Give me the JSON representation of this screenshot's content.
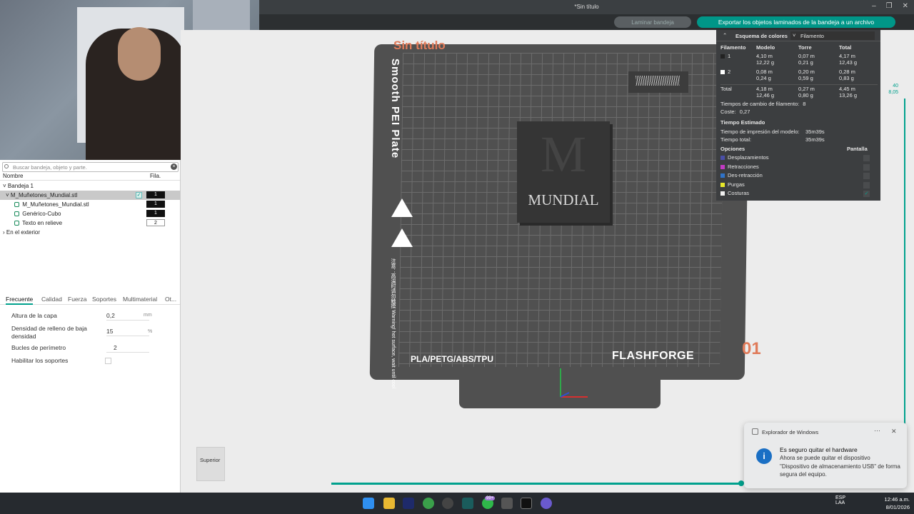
{
  "window": {
    "title": "*Sin título"
  },
  "toolbar": {
    "slice_label": "Laminar bandeja",
    "export_label": "Exportar los objetos laminados de la bandeja a un archivo"
  },
  "left_panel": {
    "search_placeholder": "Buscar bandeja, objeto y parte.",
    "col_name": "Nombre",
    "col_fila": "Fila.",
    "tree": {
      "plate": "Bandeja 1",
      "object": {
        "label": "M_Muñetones_Mundial.stl",
        "fila": "1"
      },
      "parts": [
        {
          "label": "M_Muñetones_Mundial.stl",
          "fila": "1"
        },
        {
          "label": "Genérico-Cubo",
          "fila": "1"
        },
        {
          "label": "Texto en relieve",
          "fila": "2"
        }
      ],
      "outside": "En el exterior"
    },
    "tabs": [
      "Frecuente",
      "Calidad",
      "Fuerza",
      "Soportes",
      "Multimaterial",
      "Ot..."
    ],
    "params": {
      "layer_height": {
        "label": "Altura de la capa",
        "value": "0,2",
        "unit": "mm"
      },
      "infill": {
        "label": "Densidad de relleno de baja densidad",
        "value": "15",
        "unit": "%"
      },
      "walls": {
        "label": "Bucles de perímetro",
        "value": "2"
      },
      "supports": {
        "label": "Habilitar los soportes"
      }
    }
  },
  "plate": {
    "project_title": "Sin título",
    "plate_name": "Smooth PEI Plate",
    "warning_text": "注意：高温时请勿触摸 Warning! hot surface, wait until cool",
    "materials": "PLA/PETG/ABS/TPU",
    "brand": "FLASHFORGE",
    "plate_number": "01",
    "model_letter": "M",
    "model_text": "MUNDIAL"
  },
  "color_scheme": {
    "header": "Esquema de colores",
    "mode": "Filamento",
    "columns": [
      "Filamento",
      "Modelo",
      "Torre",
      "Total"
    ],
    "rows": [
      {
        "id": "1",
        "color": "#222222",
        "model": [
          "4,10 m",
          "12,22 g"
        ],
        "tower": [
          "0,07 m",
          "0,21 g"
        ],
        "total": [
          "4,17 m",
          "12,43 g"
        ]
      },
      {
        "id": "2",
        "color": "#ffffff",
        "model": [
          "0,08 m",
          "0,24 g"
        ],
        "tower": [
          "0,20 m",
          "0,59 g"
        ],
        "total": [
          "0,28 m",
          "0,83 g"
        ]
      }
    ],
    "total_row": {
      "label": "Total",
      "model": [
        "4,18 m",
        "12,46 g"
      ],
      "tower": [
        "0,27 m",
        "0,80 g"
      ],
      "total": [
        "4,45 m",
        "13,26 g"
      ]
    },
    "changes_label": "Tiempos de cambio de filamento:",
    "changes_value": "8",
    "cost_label": "Coste:",
    "cost_value": "0,27",
    "time_header": "Tiempo Estimado",
    "model_time_label": "Tiempo de impresión del modelo:",
    "model_time_value": "35m39s",
    "total_time_label": "Tiempo total:",
    "total_time_value": "35m39s",
    "options_header": "Opciones",
    "screen_header": "Pantalla",
    "options": [
      {
        "label": "Desplazamientos",
        "color": "#4a4fa8"
      },
      {
        "label": "Retracciones",
        "color": "#c23bc2"
      },
      {
        "label": "Des-retracción",
        "color": "#2f73c8"
      },
      {
        "label": "Purgas",
        "color": "#e8e82a"
      },
      {
        "label": "Costuras",
        "color": "#f0f0f0"
      }
    ]
  },
  "slider": {
    "top_layer": "40",
    "top_height": "8,05"
  },
  "view_cube": {
    "label": "Superior"
  },
  "toast": {
    "app": "Explorador de Windows",
    "title": "Es seguro quitar el hardware",
    "message": "Ahora se puede quitar el dispositivo \"Dispositivo de almacenamiento USB\" de forma segura del equipo."
  },
  "taskbar": {
    "lang1": "ESP",
    "lang2": "LAA",
    "time": "12:46 a.m.",
    "date": "8/01/2026",
    "badge": "99+"
  },
  "colors": {
    "accent": "#00a18d",
    "project_title": "#e07b5a"
  }
}
